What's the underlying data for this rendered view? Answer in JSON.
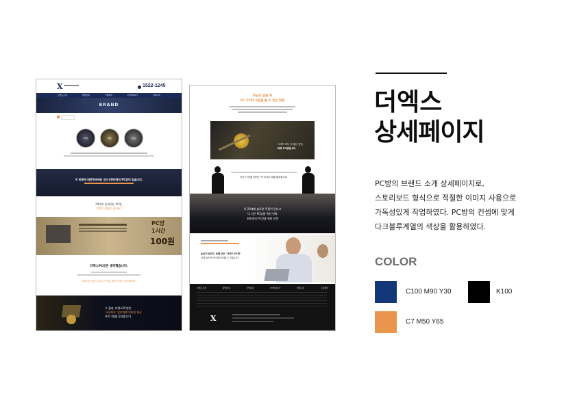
{
  "page_title": [
    "더엑스",
    "상세페이지"
  ],
  "description": [
    "PC방의 브랜드 소개 상세페이지로,",
    "스토리보드 형식으로 적절한 이미지 사용으로",
    "가독성있게 작업하였다. PC방의 컨셉에 맞게",
    "다크블루계열의 색상을 활용하였다."
  ],
  "color_section": {
    "heading": "COLOR",
    "swatches": [
      {
        "hex": "#123779",
        "label": "C100 M90 Y30"
      },
      {
        "hex": "#000000",
        "label": "K100"
      },
      {
        "hex": "#E9954E",
        "label": "C7 M50 Y65"
      }
    ]
  },
  "left_mock": {
    "phone": "1522-1245",
    "banner": "BRAND",
    "nav": [
      "브랜드소개",
      "창업안내",
      "가맹문의",
      "PC방이야기",
      "커뮤니티"
    ],
    "circles": [
      "PC방",
      "매장",
      "브랜드"
    ],
    "dark_band_text": "이 비중에 대한민국에는 1만 4천여개의 PC방이 있습니다.",
    "orange_text": "20대가 손쉬워는 PC방,",
    "orange_sub": "이대로 괜찮은 걸까요?",
    "promo_lines": [
      "PC방",
      "1시간",
      "100원"
    ],
    "question": "더엑스PC방은 생각했습니다.",
    "question_orange": "그렇다면 손님이 많은 PC방은 과연 무엇이 달랐을까요?",
    "footer_lines": [
      "그 결과, 더엑스PC방은",
      "'국내최초' 암호화폐 인터넷 제공",
      "프로그램을 운영합니다."
    ]
  },
  "right_mock": {
    "headline": [
      "손님이 없을 때",
      "PC 수익이 0원을 뚫 수 있는 방법"
    ],
    "coin_caption": "그래프 보다 더 좋은 방법,",
    "coin_caption2": "바로 PC방입니다.",
    "silhouette_caption": "단지 PC방을 원하는 게 아니라 매출 필요합니다.",
    "room_text": [
      "이 20대에 솔루션 적용이 된다고",
      "더 나은 PC방을 위한 변화",
      "300개의 PC방을 위한 선택"
    ],
    "ad_text": [
      "손님이 없어도 돈을 버는 '더엑스 PC방'",
      "이제 당신의 PC방도 바뀔 수 있습니다."
    ],
    "footer_cols": [
      "브랜드소개",
      "창업안내",
      "가맹문의",
      "PC방이야기",
      "커뮤니티",
      "고객센터"
    ]
  }
}
